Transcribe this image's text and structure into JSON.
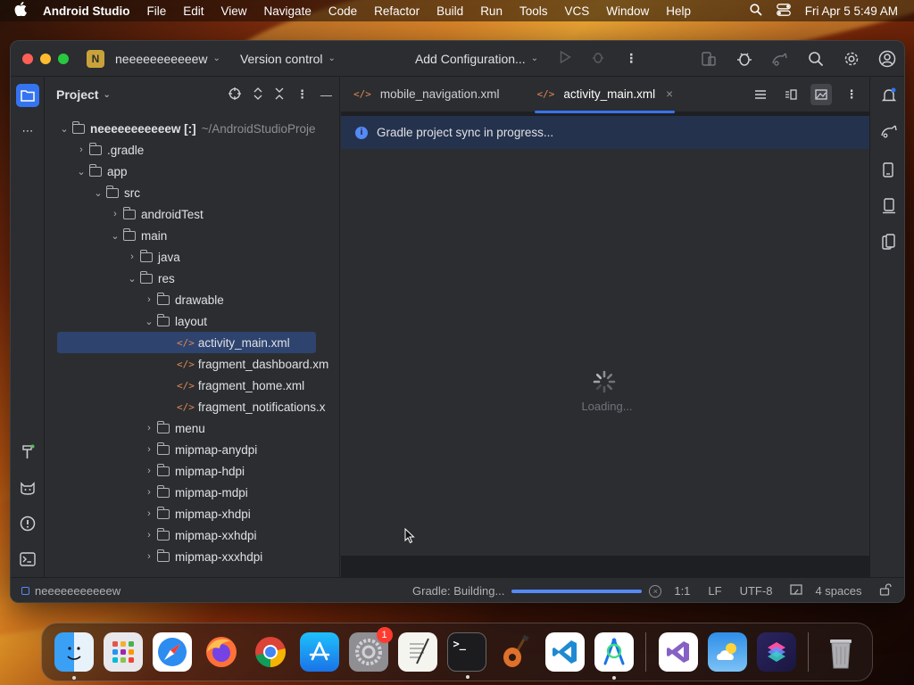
{
  "menubar": {
    "app_name": "Android Studio",
    "items": [
      "File",
      "Edit",
      "View",
      "Navigate",
      "Code",
      "Refactor",
      "Build",
      "Run",
      "Tools",
      "VCS",
      "Window",
      "Help"
    ],
    "datetime": "Fri Apr 5  5:49 AM"
  },
  "titlebar": {
    "project_badge": "N",
    "project_name": "neeeeeeeeeeew",
    "version_control": "Version control",
    "run_config": "Add Configuration..."
  },
  "project_panel": {
    "title": "Project",
    "root_name": "neeeeeeeeeeew [:]",
    "root_path": "~/AndroidStudioProje",
    "tree": [
      {
        "label": ".gradle"
      },
      {
        "label": "app"
      },
      {
        "label": "src"
      },
      {
        "label": "androidTest"
      },
      {
        "label": "main"
      },
      {
        "label": "java"
      },
      {
        "label": "res"
      },
      {
        "label": "drawable"
      },
      {
        "label": "layout"
      },
      {
        "label": "activity_main.xml"
      },
      {
        "label": "fragment_dashboard.xm"
      },
      {
        "label": "fragment_home.xml"
      },
      {
        "label": "fragment_notifications.x"
      },
      {
        "label": "menu"
      },
      {
        "label": "mipmap-anydpi"
      },
      {
        "label": "mipmap-hdpi"
      },
      {
        "label": "mipmap-mdpi"
      },
      {
        "label": "mipmap-xhdpi"
      },
      {
        "label": "mipmap-xxhdpi"
      },
      {
        "label": "mipmap-xxxhdpi"
      }
    ]
  },
  "editor": {
    "tabs": [
      {
        "label": "mobile_navigation.xml"
      },
      {
        "label": "activity_main.xml"
      }
    ],
    "banner": "Gradle project sync in progress...",
    "loading": "Loading..."
  },
  "statusbar": {
    "project": "neeeeeeeeeeew",
    "gradle": "Gradle: Building...",
    "progress": 1.0,
    "position": "1:1",
    "line_sep": "LF",
    "encoding": "UTF-8",
    "indent": "4 spaces"
  },
  "dock": {
    "settings_badge": "1",
    "apps": [
      "finder-icon",
      "launchpad-icon",
      "safari-icon",
      "firefox-icon",
      "chrome-icon",
      "app-store-icon",
      "system-settings-icon",
      "textedit-icon",
      "terminal-icon",
      "garageband-icon",
      "vscode-icon",
      "android-studio-icon",
      "visual-studio-icon",
      "weather-icon",
      "shortcuts-icon",
      "trash-icon"
    ]
  },
  "colors": {
    "accent": "#3574f0",
    "banner_bg": "#25324d",
    "selection": "#2e436e"
  }
}
